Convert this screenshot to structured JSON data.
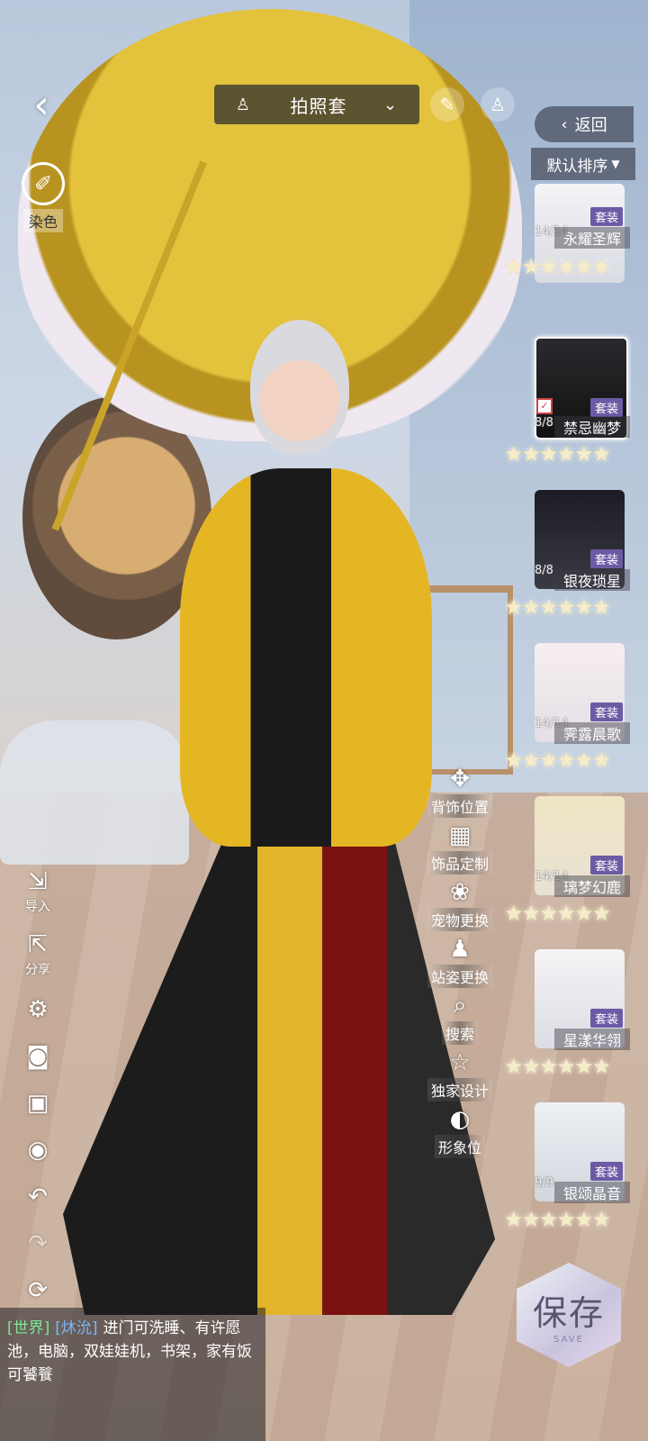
{
  "top_bar": {
    "outfit_selector": "拍照套"
  },
  "left_tools": {
    "dye_label": "染色",
    "import_label": "导入",
    "share_label": "分享"
  },
  "function_menu": [
    {
      "icon": "move-cross-icon",
      "label": "背饰位置"
    },
    {
      "icon": "accessory-custom-icon",
      "label": "饰品定制"
    },
    {
      "icon": "paw-icon",
      "label": "宠物更换"
    },
    {
      "icon": "person-pose-icon",
      "label": "站姿更换"
    },
    {
      "icon": "search-icon",
      "label": "搜索"
    },
    {
      "icon": "star-icon",
      "label": "独家设计"
    },
    {
      "icon": "portrait-icon",
      "label": "形象位"
    }
  ],
  "wardrobe": {
    "back_label": "返回",
    "sort_label": "默认排序",
    "items": [
      {
        "name": "永耀圣辉",
        "count": "14/14",
        "tag": "套装",
        "selected": false
      },
      {
        "name": "禁忌幽梦",
        "count": "8/8",
        "tag": "套装",
        "selected": true
      },
      {
        "name": "银夜琐星",
        "count": "8/8",
        "tag": "套装",
        "selected": false
      },
      {
        "name": "霁露晨歌",
        "count": "14/14",
        "tag": "套装",
        "selected": false
      },
      {
        "name": "璃梦幻鹿",
        "count": "14/14",
        "tag": "套装",
        "selected": false
      },
      {
        "name": "星漾华翎",
        "count": "",
        "tag": "套装",
        "selected": false
      },
      {
        "name": "银颂晶音",
        "count": "9/9",
        "tag": "套装",
        "selected": false
      }
    ],
    "stars": "★★★★★★"
  },
  "save_button": {
    "label": "保存",
    "sub": "SAVE"
  },
  "chat": {
    "channel": "[世界]",
    "user": "[炑沇]",
    "message": "进门可洗睡、有许愿池，电脑，双娃娃机，书架，家有饭可饕餮"
  }
}
